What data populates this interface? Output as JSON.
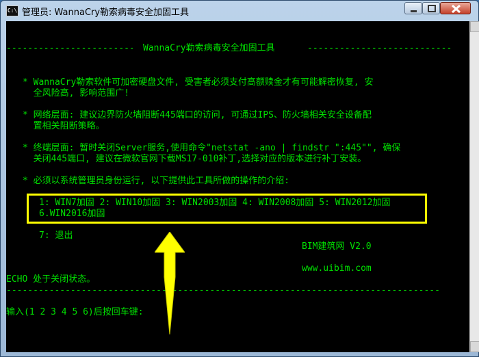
{
  "window": {
    "title": "管理员:  WannaCry勒索病毒安全加固工具",
    "icon": "console-icon",
    "buttons": [
      "minimize",
      "maximize",
      "close"
    ]
  },
  "console": {
    "dashes_left": "-------------------------",
    "header_title": "WannaCry勒索病毒安全加固工具",
    "dashes_right": "---------------------------",
    "bullets": [
      {
        "line1": "* WannaCry勒索软件可加密硬盘文件, 受害者必须支付高额赎金才有可能解密恢复, 安",
        "line2": "  全风险高, 影响范围广!"
      },
      {
        "line1": "* 网络层面: 建议边界防火墙阻断445端口的访问, 可通过IPS、防火墙相关安全设备配",
        "line2": "  置相关阻断策略。"
      },
      {
        "line1": "* 终端层面: 暂时关闭Server服务,使用命令\"netstat -ano | findstr \":445\"\", 确保",
        "line2": "  关闭445端口, 建议在微软官网下载MS17-010补丁,选择对应的版本进行补丁安装。"
      },
      {
        "line1": "* 必须以系统管理员身份运行, 以下提供此工具所做的操作的介绍:",
        "line2": ""
      }
    ],
    "menu_line1": "1: WIN7加固 2: WIN10加固 3: WIN2003加固 4: WIN2008加固 5: WIN2012加固",
    "menu_line2": "6.WIN2016加固",
    "exit_option": "7: 退出",
    "brand": "BIM建筑网 V2.0",
    "website": "www.uibim.com",
    "echo_status": "ECHO 处于关闭状态。",
    "dashes_full": "---------------------------------------------------------------------------------",
    "prompt": "输入(1 2 3 4 5 6)后按回车键:"
  },
  "colors": {
    "console_text": "#00e000",
    "console_bg": "#000000",
    "highlight": "#ffff00"
  }
}
